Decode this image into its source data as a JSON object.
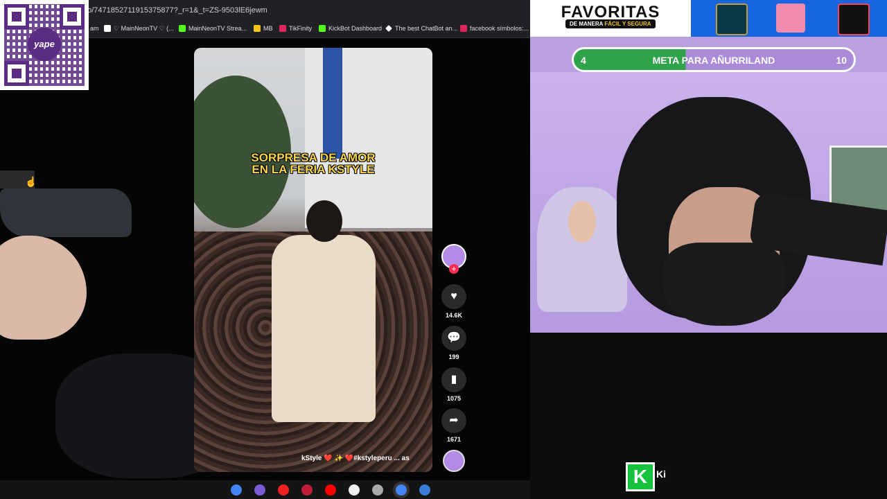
{
  "browser": {
    "url": "eo/7471852711915375877?_r=1&_t=ZS-9503lE6jewm",
    "bookmarks": [
      {
        "label": "am",
        "color": "#888888"
      },
      {
        "label": "♡ MainNeonTV ♡ (...",
        "color": "#ffffff"
      },
      {
        "label": "MainNeonTV Strea...",
        "color": "#53fc18"
      },
      {
        "label": "MB",
        "color": "#f5c518"
      },
      {
        "label": "TikFinity",
        "color": "#e0245e"
      },
      {
        "label": "KickBot Dashboard",
        "color": "#53fc18"
      },
      {
        "label": "The best ChatBot an...",
        "color": "#ffffff"
      },
      {
        "label": "facebook símbolos:...",
        "color": "#e0245e"
      }
    ]
  },
  "qr": {
    "brand": "yape"
  },
  "video": {
    "caption_line1": "SORPRESA DE AMOR",
    "caption_line2": "EN LA FERIA KSTYLE",
    "hashtags": "kStyle ❤️ ✨ ❤️#kstyleperu ... as",
    "likes": "14.6K",
    "comments": "199",
    "saves": "1075",
    "shares": "1671"
  },
  "icons": {
    "like": "heart-icon",
    "comment": "comment-icon",
    "save": "bookmark-icon",
    "share": "share-icon"
  },
  "overlay": {
    "favoritas_title": "FAVORITAS",
    "favoritas_sub_prefix": "DE MANERA ",
    "favoritas_sub_highlight": "FÁCIL Y SEGURA",
    "goal_current": "4",
    "goal_label": "META PARA AÑURRILAND",
    "goal_target": "10",
    "goal_progress": 0.4
  },
  "kick": {
    "logo": "K",
    "text": "Ki"
  },
  "colors": {
    "goal_fill": "#2fa34a",
    "goal_track": "#a98bd7",
    "tiktok_red": "#fe2c55",
    "games_bg": "#1766e0"
  }
}
